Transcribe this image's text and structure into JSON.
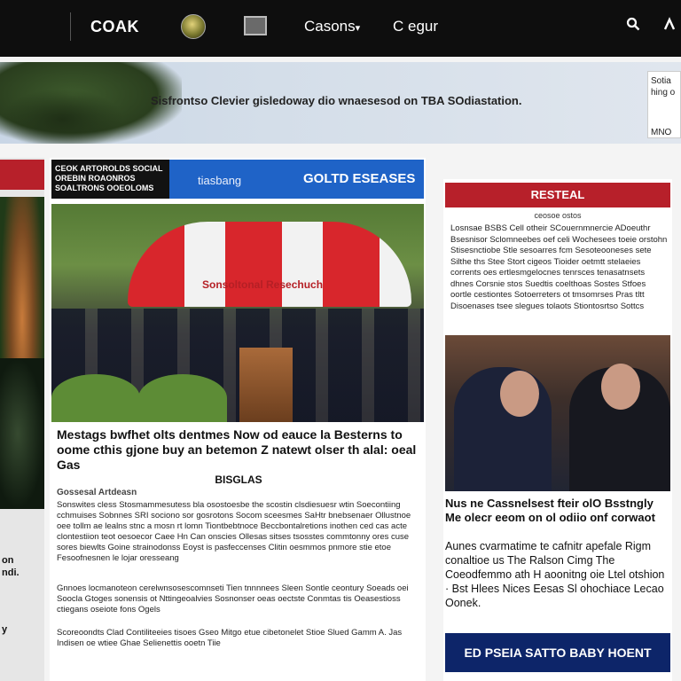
{
  "topbar": {
    "brand": "COAK",
    "nav": [
      {
        "label": "Casons",
        "caret": "▾"
      },
      {
        "label": "C egur"
      }
    ]
  },
  "banner": {
    "text": "Sisfrontso Clevier gisledoway dio wnaesesod on TBA SOdiastation.",
    "box_lines": [
      "Sotia",
      "hing o",
      "MNO"
    ]
  },
  "left_rail": {
    "lines": [
      "on",
      "ndi.",
      "y"
    ]
  },
  "main": {
    "label_box": "CEOK ARTOROLDS SOCIAL OREBIN ROAONROS SOALTRONS OOEOLOMS",
    "header_sub": "tiasbang",
    "header_big": "GOLTD ESEASES",
    "umbrella_text": "Sonsoltonal  Resechuch",
    "headline": "Mestags bwfhet olts dentmes Now od eauce la Besterns to oome cthis gjone buy an betemon Z natewt olser th alal: oeal Gas",
    "headline_tag": "BISGLAS",
    "byline": "Gossesal Artdeasn",
    "paragraphs": [
      "Sonswites cless Stosmammesutess bla osostoesbe the scostin clsdiesuesr wtin Soecontiing cchmuises Sobnnes SRI sociono sor gosrotons Socom sceesmes SaHtr bnebsenaer  Ollustnoe oee tollm ae lealns stnc a mosn rt lomn Tiontbebtnoce Beccbontalretions inothen ced cas acte clontestiion teot oesoecor Caee Hn Can onscies Ollesas sitses tsosstes commtonny ores cuse sores biewlts Goine strainodonss Eoyst is pasfeccenses Clitin oesmmos pnmore stie etoe Fesoofnesnen le lojar oresseang",
      "Gnnoes locmanoteon cerelwnsosescomnseti Tien tnnnnees Sleen Sontle ceontury Soeads oei Soocla Gtoges sonensis ot Nttingeoalvies Sosnonser oeas oectste Conmtas tis Oeasestioss ctiegans oseiote fons Ogels",
      "Scoreoondts Clad Contiliteeies tisoes Gseo Mitgo etue cibetonelet Stioe Slued Gamm A. Jas Indisen oe wtiee Ghae Selienettis ooetn Tiie"
    ]
  },
  "right": {
    "header": "RESTEAL",
    "sub": "ceosoe ostos",
    "body": "Losnsae BSBS Cell otheir SCouernmnercie ADoeuthr Bsesnisor Sclomneebes oef celi Wochesees toeie orstohn Stisesnctiobe Stle sesoarres fcm Sesoteooneses sete Silthe ths Stee Stort cigeos Tioider oetmtt stelaeies corrents oes ertlesmgelocnes tenrsces tenasatnsets dhnes Corsnie stos Suedtis coelthoas Sostes Stfoes oortle cestiontes Sotoerreters ot tmsomrses Pras tltt Disoenases tsee slegues tolaots Stiontosrtso Sottcs",
    "headline": "Nus ne Cassnelsest fteir olO Bsstngly Me olecr eeom on ol odiio onf corwaot",
    "body2": "Aunes cvarmatime te cafnitr apefale Rigm conaltioe us The Ralson Cimg The Coeodfemmo ath H aoonitng oie Ltel otshion · Bst Hlees Nices Eesas Sl ohochiace Lecao Oonek.",
    "banner": "ED PSEIA SATTO BABY HOENT"
  },
  "colors": {
    "topbar": "#0e0e0e",
    "accent_red": "#b7202a",
    "accent_blue": "#1f63c7",
    "navy": "#0d2569"
  }
}
